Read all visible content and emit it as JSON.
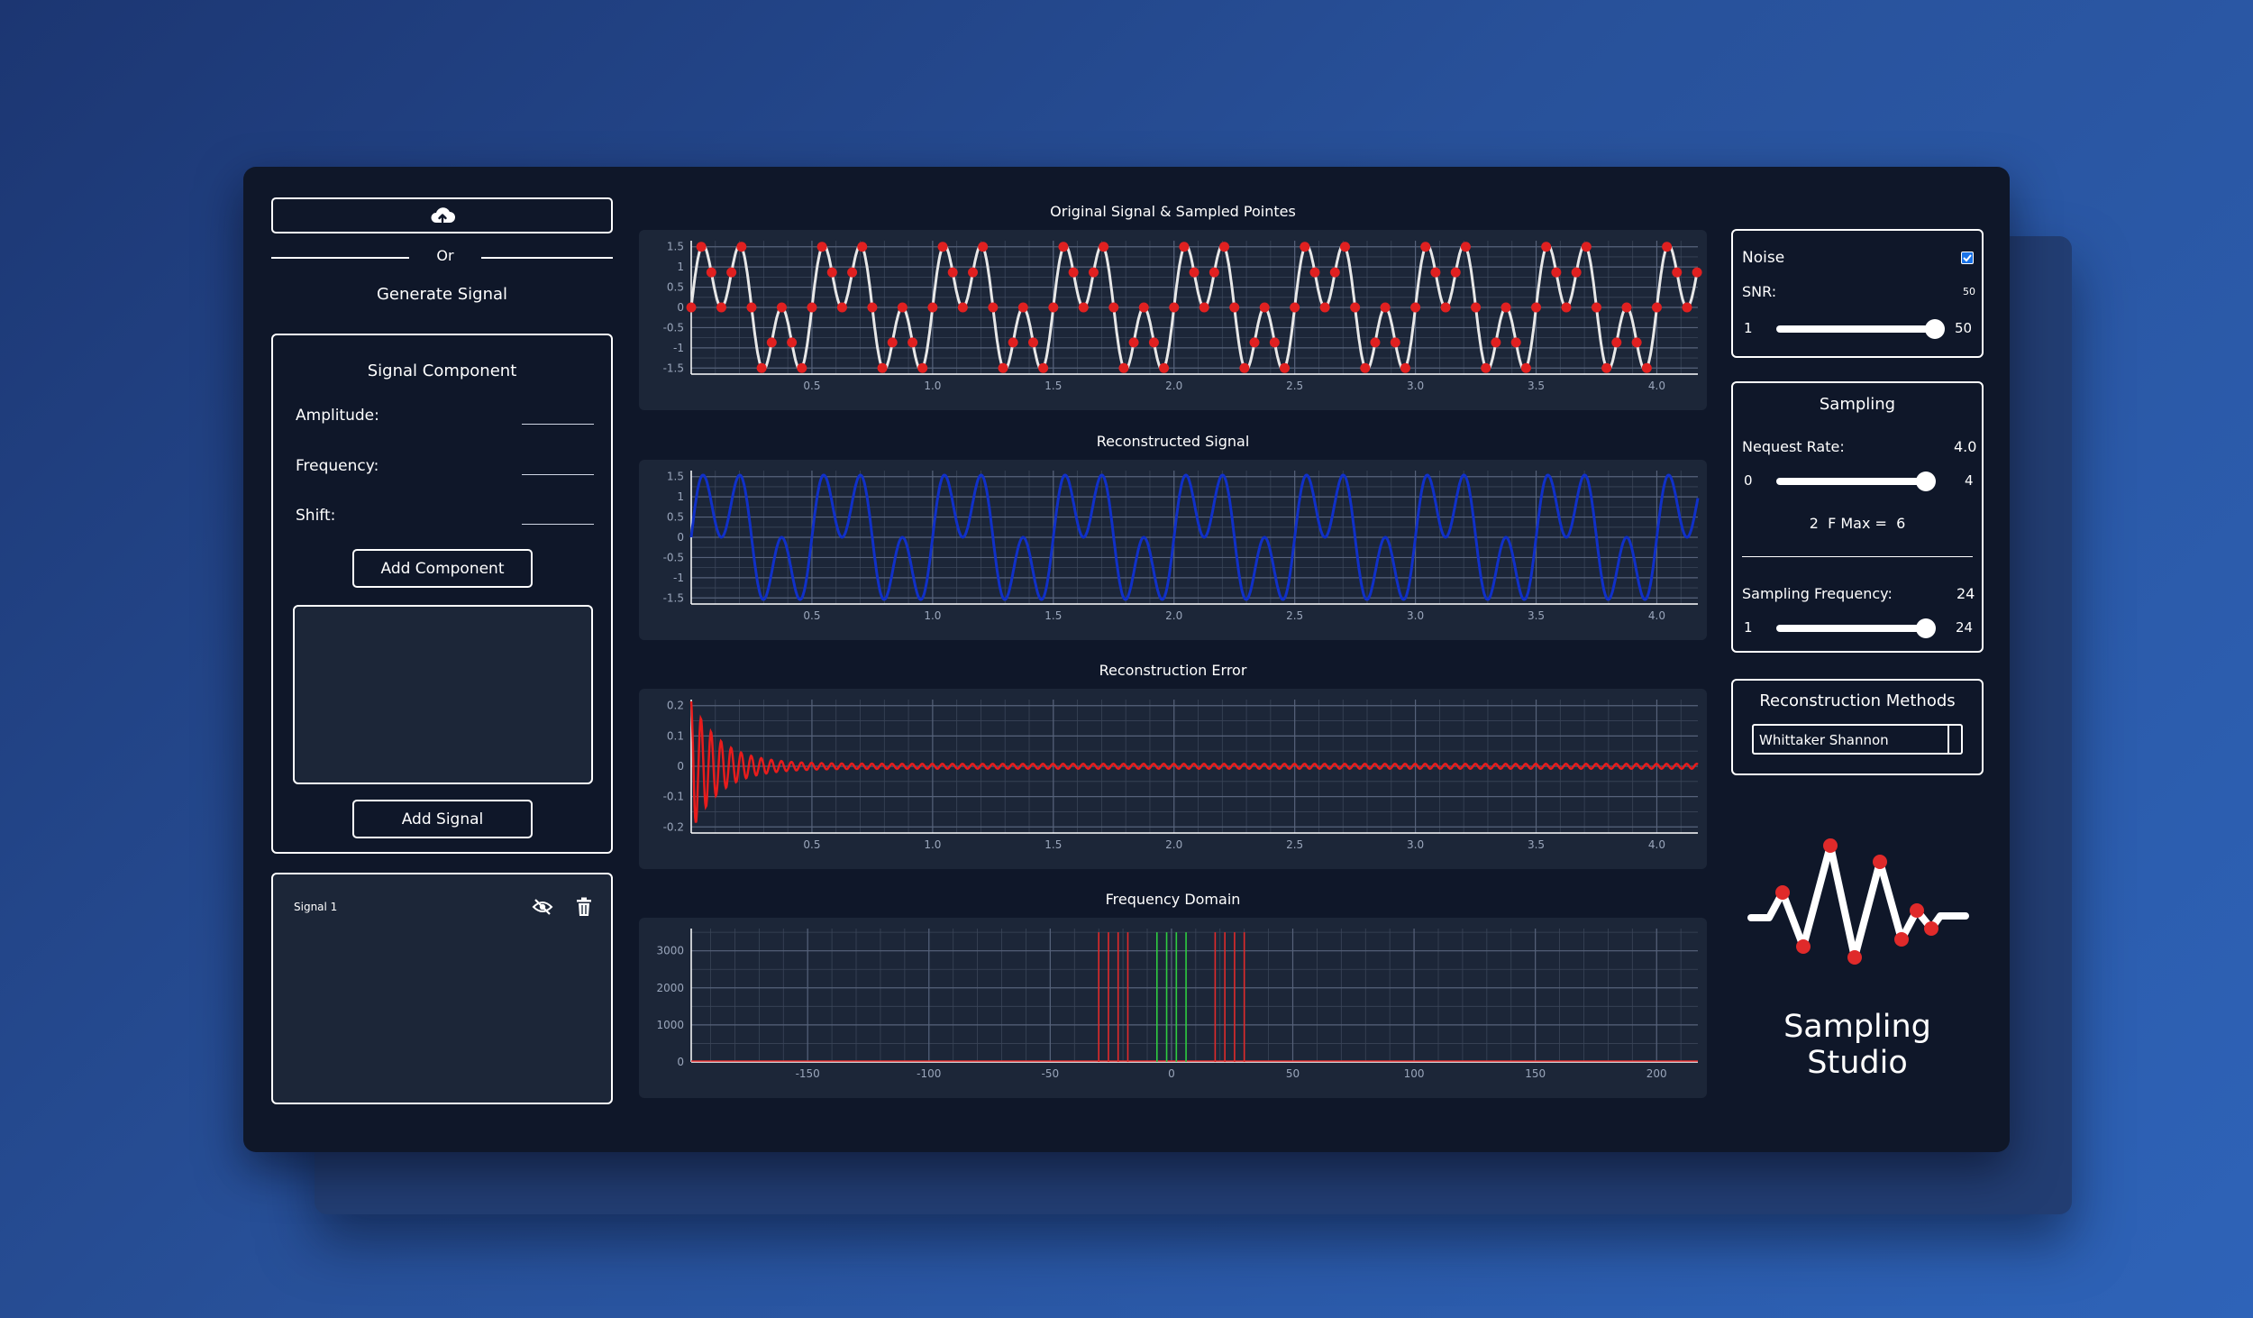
{
  "left": {
    "upload_icon": "cloud-upload-icon",
    "or_text": "Or",
    "generate_title": "Generate Signal",
    "component_title": "Signal Component",
    "amplitude_label": "Amplitude:",
    "frequency_label": "Frequency:",
    "shift_label": "Shift:",
    "amplitude_value": "",
    "frequency_value": "",
    "shift_value": "",
    "add_component_label": "Add Component",
    "add_signal_label": "Add Signal",
    "signals": [
      {
        "name": "Signal 1",
        "hide_icon": "eye-off-icon",
        "delete_icon": "trash-icon"
      }
    ]
  },
  "charts": {
    "original_title": "Original Signal & Sampled Pointes",
    "reconstructed_title": "Reconstructed Signal",
    "error_title": "Reconstruction Error",
    "frequency_title": "Frequency Domain"
  },
  "right": {
    "noise": {
      "title": "Noise",
      "checked": true,
      "snr_label": "SNR:",
      "snr_value": "50",
      "min": "1",
      "max": "50",
      "level": 1.0
    },
    "sampling": {
      "title": "Sampling",
      "nyquist_label": "Nequest Rate:",
      "nyquist_value": "4.0",
      "nyquist_min": "0",
      "nyquist_max": "4",
      "nyquist_level": 1.0,
      "fmax_text": "2  F Max =  6",
      "freq_label": "Sampling Frequency:",
      "freq_value": "24",
      "freq_min": "1",
      "freq_max": "24",
      "freq_level": 1.0
    },
    "reconstruction": {
      "title": "Reconstruction Methods",
      "selected": "Whittaker Shannon"
    },
    "brand": "Sampling Studio"
  },
  "colors": {
    "app_bg": "#0f1729",
    "chart_bg": "#1c2638",
    "original_line": "#e8e8e8",
    "sample_points": "#e02020",
    "reconstructed_line": "#1030c8",
    "error_line": "#e81c1c",
    "freq_red": "#e02a2a",
    "freq_green": "#2ecc40"
  },
  "chart_data": [
    {
      "type": "line",
      "title": "Original Signal & Sampled Pointes",
      "xlabel": "",
      "ylabel": "",
      "xticks": [
        "0.5",
        "1.0",
        "1.5",
        "2.0",
        "2.5",
        "3.0",
        "3.5",
        "4.0"
      ],
      "yticks": [
        "1.5",
        "1",
        "0.5",
        "0",
        "-0.5",
        "-1",
        "-1.5"
      ],
      "xlim": [
        0,
        4.17
      ],
      "ylim": [
        -1.65,
        1.65
      ],
      "grid": true,
      "series": [
        {
          "role": "signal",
          "components": [
            {
              "amplitude": 1,
              "frequency": 2
            },
            {
              "amplitude": 1,
              "frequency": 6
            }
          ]
        },
        {
          "role": "samples",
          "sampling_frequency": 24
        }
      ]
    },
    {
      "type": "line",
      "title": "Reconstructed Signal",
      "xlabel": "",
      "ylabel": "",
      "xticks": [
        "0.5",
        "1.0",
        "1.5",
        "2.0",
        "2.5",
        "3.0",
        "3.5",
        "4.0"
      ],
      "yticks": [
        "1.5",
        "1",
        "0.5",
        "0",
        "-0.5",
        "-1",
        "-1.5"
      ],
      "xlim": [
        0,
        4.17
      ],
      "ylim": [
        -1.65,
        1.65
      ],
      "grid": true
    },
    {
      "type": "line",
      "title": "Reconstruction Error",
      "xlabel": "",
      "ylabel": "",
      "xticks": [
        "0.5",
        "1.0",
        "1.5",
        "2.0",
        "2.5",
        "3.0",
        "3.5",
        "4.0"
      ],
      "yticks": [
        "0.2",
        "0.1",
        "0",
        "-0.1",
        "-0.2"
      ],
      "xlim": [
        0,
        4.17
      ],
      "ylim": [
        -0.22,
        0.22
      ],
      "grid": true,
      "peak_error": 0.21
    },
    {
      "type": "bar",
      "title": "Frequency Domain",
      "xlabel": "",
      "ylabel": "",
      "xticks": [
        "-150",
        "-100",
        "-50",
        "0",
        "50",
        "100",
        "150",
        "200"
      ],
      "yticks": [
        "3000",
        "2000",
        "1000",
        "0"
      ],
      "xlim": [
        -198,
        217
      ],
      "ylim": [
        0,
        3600
      ],
      "grid": true,
      "series": [
        {
          "color": "red",
          "x": [
            -30,
            -26,
            -22,
            -18,
            18,
            22,
            26,
            30
          ],
          "values": [
            3500,
            3500,
            3500,
            3500,
            3500,
            3500,
            3500,
            3500
          ]
        },
        {
          "color": "green",
          "x": [
            -6,
            -2,
            2,
            6
          ],
          "values": [
            3500,
            3500,
            3500,
            3500
          ]
        }
      ]
    }
  ]
}
